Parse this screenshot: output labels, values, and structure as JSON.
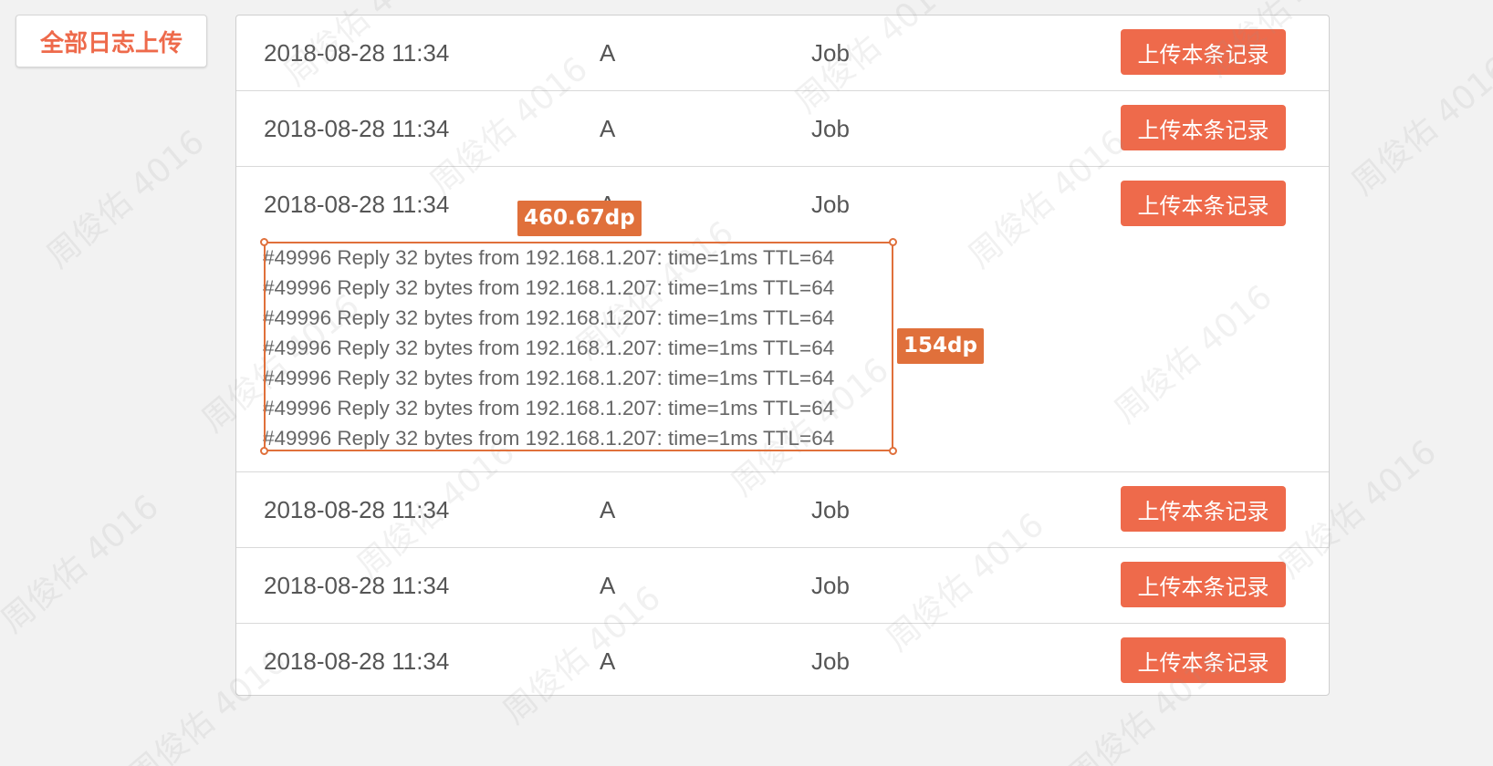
{
  "toolbar": {
    "upload_all_label": "全部日志上传"
  },
  "rows_top": [
    {
      "time": "2018-08-28 11:34",
      "type": "A",
      "job": "Job",
      "button": "上传本条记录"
    },
    {
      "time": "2018-08-28 11:34",
      "type": "A",
      "job": "Job",
      "button": "上传本条记录"
    }
  ],
  "expanded_row": {
    "time": "2018-08-28 11:34",
    "type": "A",
    "job": "Job",
    "button": "上传本条记录",
    "log_lines": [
      "#49996 Reply 32 bytes from 192.168.1.207: time=1ms TTL=64",
      "#49996 Reply 32 bytes from 192.168.1.207: time=1ms TTL=64",
      "#49996 Reply 32 bytes from 192.168.1.207: time=1ms TTL=64",
      "#49996 Reply 32 bytes from 192.168.1.207: time=1ms TTL=64",
      "#49996 Reply 32 bytes from 192.168.1.207: time=1ms TTL=64",
      "#49996 Reply 32 bytes from 192.168.1.207: time=1ms TTL=64",
      "#49996 Reply 32 bytes from 192.168.1.207: time=1ms TTL=64"
    ]
  },
  "rows_bottom": [
    {
      "time": "2018-08-28 11:34",
      "type": "A",
      "job": "Job",
      "button": "上传本条记录"
    },
    {
      "time": "2018-08-28 11:34",
      "type": "A",
      "job": "Job",
      "button": "上传本条记录"
    },
    {
      "time": "2018-08-28 11:34",
      "type": "A",
      "job": "Job",
      "button": "上传本条记录"
    }
  ],
  "measure": {
    "width_label": "460.67dp",
    "height_label": "154dp"
  },
  "watermark": "周俊佑 4016",
  "colors": {
    "accent": "#ee6a4b",
    "measure": "#e0703b",
    "background": "#f2f2f2"
  }
}
